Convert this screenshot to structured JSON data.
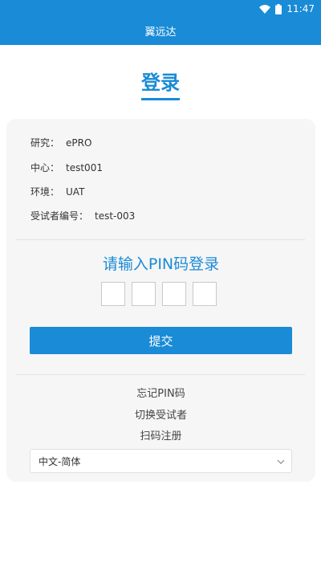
{
  "status_bar": {
    "time": "11:47",
    "icons": [
      "wifi-icon",
      "battery-icon"
    ]
  },
  "app_bar": {
    "title": "翼远达"
  },
  "login": {
    "heading": "登录"
  },
  "info": [
    {
      "label": "研究：",
      "value": "ePRO"
    },
    {
      "label": "中心：",
      "value": "test001"
    },
    {
      "label": "环境：",
      "value": "UAT"
    },
    {
      "label": "受试者编号：",
      "value": "test-003"
    }
  ],
  "pin": {
    "title": "请输入PIN码登录",
    "digits": [
      "",
      "",
      "",
      ""
    ]
  },
  "submit_label": "提交",
  "links": {
    "forgot_pin": "忘记PIN码",
    "switch_subject": "切换受试者",
    "scan_register": "扫码注册"
  },
  "language": {
    "selected": "中文-简体"
  },
  "colors": {
    "primary": "#1a8bd6",
    "card_bg": "#f6f6f6"
  }
}
